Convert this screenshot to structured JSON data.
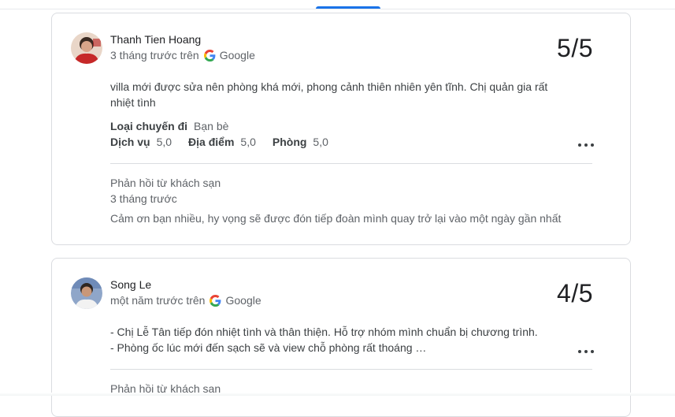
{
  "colors": {
    "accent": "#1a73e8",
    "divider": "#dadce0",
    "text": "#3c4043",
    "muted": "#5f6368"
  },
  "reviews": [
    {
      "author": "Thanh Tien Hoang",
      "time": "3 tháng trước trên",
      "source": "Google",
      "score": "5/5",
      "text": "villa mới được sửa nên phòng khá mới, phong cảnh thiên nhiên yên tĩnh. Chị quản gia rất nhiệt tình",
      "trip_type_label": "Loại chuyến đi",
      "trip_type_value": "Bạn bè",
      "ratings": [
        {
          "label": "Dịch vụ",
          "value": "5,0"
        },
        {
          "label": "Địa điểm",
          "value": "5,0"
        },
        {
          "label": "Phòng",
          "value": "5,0"
        }
      ],
      "response_title": "Phản hồi từ khách sạn",
      "response_time": "3 tháng trước",
      "response_text": "Cảm ơn bạn nhiều, hy vọng sẽ được đón tiếp đoàn mình quay trở lại vào một ngày gần nhất",
      "more_icon": "more-horiz-icon"
    },
    {
      "author": "Song Le",
      "time": "một năm trước trên",
      "source": "Google",
      "score": "4/5",
      "text_line1": "- Chị Lễ Tân tiếp đón nhiệt tình và thân thiện. Hỗ trợ nhóm mình chuẩn bị chương trình.",
      "text_line2": "- Phòng ốc lúc mới đến sạch sẽ và view chỗ phòng rất thoáng …",
      "response_title": "Phản hồi từ khách sạn",
      "more_icon": "more-horiz-icon"
    }
  ]
}
